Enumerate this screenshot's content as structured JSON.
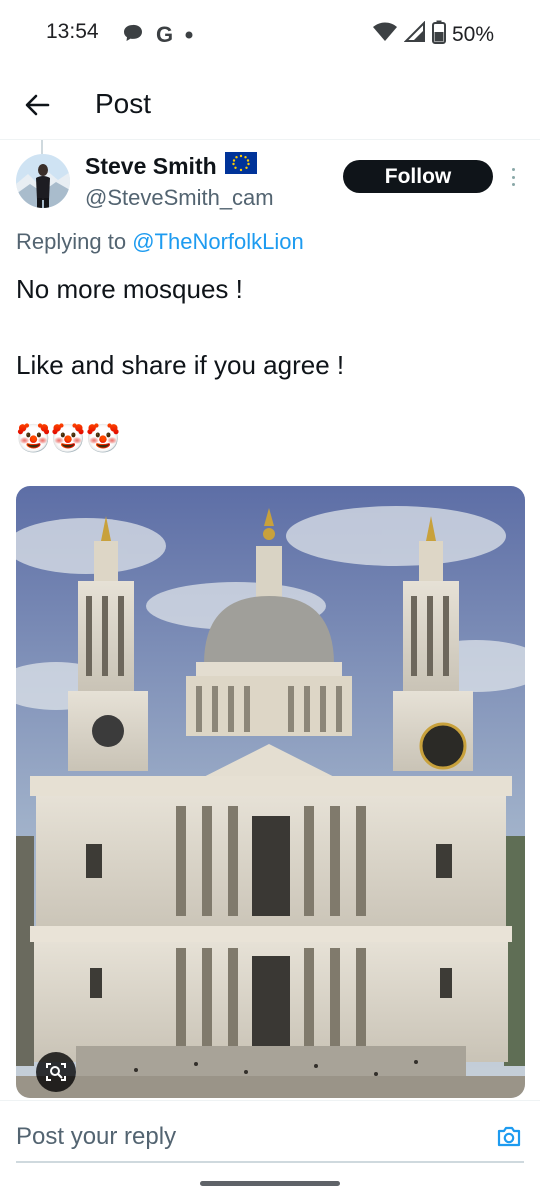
{
  "status_bar": {
    "time": "13:54",
    "notification_icons": [
      "message-bubble-icon",
      "google-g-icon",
      "dot-icon"
    ],
    "system_icons": [
      "wifi-icon",
      "cell-signal-icon",
      "battery-icon"
    ],
    "battery": "50%"
  },
  "header": {
    "title": "Post",
    "back_icon": "back-arrow-icon"
  },
  "post": {
    "author": {
      "name": "Steve Smith",
      "flag": "eu-flag-icon",
      "handle": "@SteveSmith_cam"
    },
    "follow_label": "Follow",
    "replying_prefix": "Replying to",
    "replying_to": "@TheNorfolkLion",
    "text_lines": [
      "No more mosques !",
      "Like and share if you agree !"
    ],
    "emojis": "🤡🤡🤡",
    "media_icon": "image-search-icon"
  },
  "reply": {
    "placeholder": "Post your reply",
    "camera_icon": "camera-icon"
  },
  "colors": {
    "accent": "#1d9bf0",
    "text": "#0f1419",
    "secondary_text": "#536471",
    "follow_bg": "#0f1419"
  }
}
